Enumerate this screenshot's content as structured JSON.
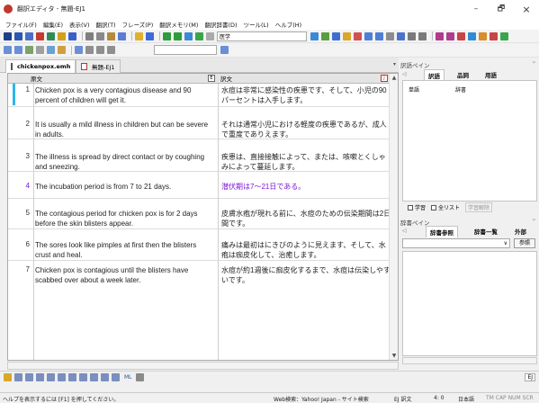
{
  "window": {
    "title": "翻訳エディタ - 無題-EJ1",
    "minimize_glyph": "–",
    "restore_glyph": "🗗",
    "close_glyph": "×"
  },
  "menu": [
    "ファイル(F)",
    "編集(E)",
    "表示(V)",
    "翻訳(T)",
    "フレーズ(P)",
    "翻訳メモリ(M)",
    "翻訳辞書(D)",
    "ツール(L)",
    "ヘルプ(H)"
  ],
  "toolbar": {
    "dictionary_select": "医学"
  },
  "tabs": [
    {
      "label": "chickenpox.emh",
      "close": "×"
    },
    {
      "label": "無題-EJ1"
    }
  ],
  "grid": {
    "source_header": "原文",
    "target_header": "訳文",
    "rows": [
      {
        "num": "1",
        "source": "Chicken pox is a very contagious disease and 90 percent of children will get it.",
        "target": "水痘は非常に感染性の疾患です、そして、小児の90パーセントは入手します。"
      },
      {
        "num": "2",
        "source": "It is usually a mild illness in children but can be severe in adults.",
        "target": "それは通常小児における軽度の疾患であるが、成人で重度でありえます。"
      },
      {
        "num": "3",
        "source": "The illness is spread by direct contact or by coughing and sneezing.",
        "target": "疾患は、直接接触によって、または、咳嗽とくしゃみによって蔓延します。"
      },
      {
        "num": "4",
        "source": "The incubation period is from 7 to 21 days.",
        "target": "潜伏期は7〜21日である。"
      },
      {
        "num": "5",
        "source": "The contagious period for chicken pox is for 2 days before the skin blisters appear.",
        "target": "皮膚水疱が現れる前に、水痘のための伝染期間は2日間です。"
      },
      {
        "num": "6",
        "source": "The sores look like pimples at first then the blisters crust and heal.",
        "target": "痛みは最初はにきびのように見えます、そして、水疱は痂皮化して、治癒します。"
      },
      {
        "num": "7",
        "source": "Chicken pox is contagious until the blisters have scabbed over about a week later.",
        "target": "水痘が約1週後に痂皮化するまで、水痘は伝染しやすいです。"
      }
    ]
  },
  "translation_panel": {
    "title": "訳語ペイン",
    "tabs": [
      "訳語",
      "品詞",
      "用語"
    ],
    "col_word": "単語",
    "col_dict": "辞書",
    "check_learn": "学習",
    "check_list": "全リスト",
    "learn_button": "学習解除"
  },
  "dictionary_panel": {
    "title": "辞書ペイン",
    "tabs": [
      "辞書参照",
      "辞書一覧",
      "外部"
    ],
    "lookup_button": "参照"
  },
  "bottom_toolbar": {
    "label": "ML"
  },
  "status": {
    "help": "ヘルプを表示するには [F1] を押してください。",
    "web_search": "Web検索：Yahoo! Japan - サイト検索",
    "mode": "EJ 訳文",
    "position": "4: 0",
    "language": "日本語",
    "keys": "TM CAP NUM SCR"
  },
  "colors": {
    "current_row": "#7a19d8",
    "row_marker": "#2fb6e6"
  }
}
